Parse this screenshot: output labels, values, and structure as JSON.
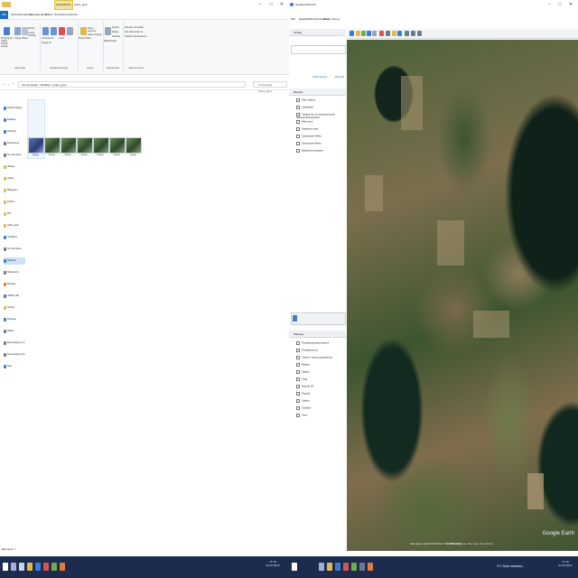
{
  "explorer": {
    "title": "pole1_gree",
    "context_tab": "Zarządzanie",
    "ribbon_tabs": [
      "Plik",
      "Narzędzia główne",
      "Udostępnianie",
      "Widok",
      "Narzędzia obrazów"
    ],
    "ribbon_groups": [
      "Schowek",
      "Organizowanie",
      "Nowy",
      "Otwieranie",
      "Zaznaczanie"
    ],
    "ribbon_items": {
      "pin": "Przypnij do paska Szybki dostęp",
      "copy": "Kopiuj",
      "paste": "Wklej",
      "cut": "Wytnij",
      "copy_path": "Kopiuj ścieżkę",
      "paste_shortcut": "Wklej skrót",
      "move_to": "Przenieś do",
      "copy_to": "Kopiuj do",
      "delete": "Usuń",
      "rename": "Zmień nazwę",
      "new_folder": "Nowy folder",
      "new_item": "Nowy element",
      "easy_access": "Łatwy dostęp",
      "properties": "Właściwości",
      "open": "Otwórz",
      "edit": "Edytuj",
      "history": "Historia",
      "select_all": "Zaznacz wszystko",
      "select_none": "Nie zaznaczaj nic",
      "invert_selection": "Odwróć zaznaczenie"
    },
    "address": "Ten komputer › Desktop › pole1_gree",
    "search_placeholder": "Przeszukaj: pole1_gree",
    "nav_items": [
      {
        "label": "Szybki dostęp",
        "icon": "star-icon",
        "color": "#3b7bd0"
      },
      {
        "label": "Desktop",
        "icon": "desktop-icon",
        "color": "#3b7bd0"
      },
      {
        "label": "Pobrane",
        "icon": "download-icon",
        "color": "#3b7bd0"
      },
      {
        "label": "Dokumenty",
        "icon": "documents-icon",
        "color": "#6b7a8f"
      },
      {
        "label": "Ten komputer",
        "icon": "computer-icon",
        "color": "#6b7a8f"
      },
      {
        "label": "Obrazy",
        "icon": "pictures-icon",
        "color": "#e0b94a"
      },
      {
        "label": "Arkali",
        "icon": "folder-icon",
        "color": "#e0b94a"
      },
      {
        "label": "Mikogram",
        "icon": "folder-icon",
        "color": "#e0b94a"
      },
      {
        "label": "Python",
        "icon": "folder-icon",
        "color": "#e0b94a"
      },
      {
        "label": "STL",
        "icon": "folder-icon",
        "color": "#e0b94a"
      },
      {
        "label": "pole1_gree",
        "icon": "folder-icon",
        "color": "#e0b94a"
      },
      {
        "label": "OneDrive",
        "icon": "cloud-icon",
        "color": "#3b7bd0"
      },
      {
        "label": "Ten komputer",
        "icon": "computer-icon",
        "color": "#6b7a8f"
      },
      {
        "label": "Desktop",
        "icon": "desktop-icon",
        "color": "#3b7bd0"
      },
      {
        "label": "Dokumenty",
        "icon": "documents-icon",
        "color": "#6b7a8f"
      },
      {
        "label": "Muzyka",
        "icon": "music-icon",
        "color": "#e07b39"
      },
      {
        "label": "Obiekty 3D",
        "icon": "cube-icon",
        "color": "#3b7bd0"
      },
      {
        "label": "Obrazy",
        "icon": "pictures-icon",
        "color": "#e0b94a"
      },
      {
        "label": "Pobrane",
        "icon": "download-icon",
        "color": "#3b7bd0"
      },
      {
        "label": "Wideo",
        "icon": "video-icon",
        "color": "#6b7a8f"
      },
      {
        "label": "Dysk lokalny (C:)",
        "icon": "drive-icon",
        "color": "#6b7a8f"
      },
      {
        "label": "Dysk lokalny (D:)",
        "icon": "drive-icon",
        "color": "#6b7a8f"
      },
      {
        "label": "Sieć",
        "icon": "network-icon",
        "color": "#3b7bd0"
      }
    ],
    "files": [
      "1.jpeg",
      "2.jpeg",
      "3.jpeg",
      "4.jpeg",
      "5.jpeg",
      "6.jpeg",
      "7.jpeg"
    ],
    "status": "Elementy: 7"
  },
  "earth": {
    "title": "Google Earth Pro",
    "menu": [
      "Plik",
      "Edycja",
      "Widok",
      "Narzędzia",
      "Dodaj",
      "Pomoc"
    ],
    "search_header": "Szukaj",
    "search_buttons": [
      "Pokaż historię",
      "Wyczyść"
    ],
    "places_header": "Miejsca",
    "places": [
      "Moje miejsca",
      "Zwiedzanie",
      "Upewnij się, że zaznaczona jest warstwa 3D budynków",
      "Wiek ziemi",
      "Świadomy trasy",
      "Zachowanie Wieku",
      "Zachowanie Wieży",
      "Miejsca tymczasowe"
    ],
    "layers_header": "Warstwy",
    "layers": [
      "Podstawowa baza danych",
      "Powiadomienia",
      "Granice i nazwy geograficzne",
      "Miejsca",
      "Zdjęcia",
      "Drogi",
      "Budynki 3D",
      "Pogoda",
      "Galeria",
      "Globalne",
      "Teren"
    ],
    "brand": "Google Earth",
    "map_credit": "© 2023 Google",
    "coords": "Data zdjęcia: 4/2022   53°52'19.11\" N   21°34'41.53\" E   wys. 131 m   wys. oczu 3.51 km"
  },
  "taskbar": {
    "left_clock_time": "17:18",
    "left_clock_date": "04.02.2023",
    "right_clock_time": "17:19",
    "right_clock_date": "04.02.2023",
    "weather": "1°C Duże zachmur..."
  }
}
